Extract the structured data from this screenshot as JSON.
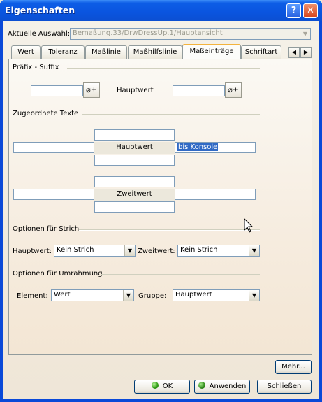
{
  "window": {
    "title": "Eigenschaften"
  },
  "titlebar_buttons": {
    "help": "?",
    "close": "✕"
  },
  "selection": {
    "label": "Aktuelle Auswahl:",
    "value": "Bemaßung.33/DrwDressUp.1/Hauptansicht"
  },
  "tabs": [
    "Wert",
    "Toleranz",
    "Maßlinie",
    "Maßhilfslinie",
    "Maßeinträge",
    "Schriftart"
  ],
  "active_tab": "Maßeinträge",
  "tab_scroll": {
    "left": "◀",
    "right": "▶"
  },
  "prefix_suffix": {
    "heading": "Präfix - Suffix",
    "prefix_value": "",
    "suffix_value": "",
    "center_label": "Hauptwert",
    "symbol_icon": "diameter-symbol-icon"
  },
  "assoc_texts": {
    "heading": "Zugeordnete Texte",
    "main": {
      "label": "Hauptwert",
      "above": "",
      "below": "",
      "before": "",
      "after": "bis Konsole"
    },
    "second": {
      "label": "Zweitwert",
      "above": "",
      "below": "",
      "before": "",
      "after": ""
    }
  },
  "line_options": {
    "heading": "Optionen für Strich",
    "main_label": "Hauptwert:",
    "main_value": "Kein Strich",
    "second_label": "Zweitwert:",
    "second_value": "Kein Strich"
  },
  "frame_options": {
    "heading": "Optionen für Umrahmung",
    "element_label": "Element:",
    "element_value": "Wert",
    "group_label": "Gruppe:",
    "group_value": "Hauptwert"
  },
  "buttons": {
    "more": "Mehr...",
    "ok": "OK",
    "apply": "Anwenden",
    "close": "Schließen"
  },
  "colors": {
    "title_bar": "#0a55e0",
    "selection_highlight": "#316ac5",
    "active_tab_accent": "#f3b33e"
  }
}
